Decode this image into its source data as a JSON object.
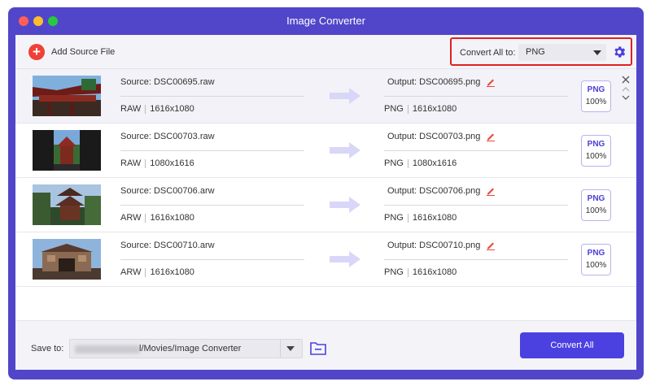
{
  "window": {
    "title": "Image Converter"
  },
  "toolbar": {
    "add_label": "Add Source File",
    "convert_all_label": "Convert All to:",
    "format_selected": "PNG"
  },
  "files": [
    {
      "source_name": "Source: DSC00695.raw",
      "source_format": "RAW",
      "source_dims": "1616x1080",
      "output_name": "Output: DSC00695.png",
      "output_format": "PNG",
      "output_dims": "1616x1080",
      "badge_format": "PNG",
      "badge_quality": "100%",
      "selected": true
    },
    {
      "source_name": "Source: DSC00703.raw",
      "source_format": "RAW",
      "source_dims": "1080x1616",
      "output_name": "Output: DSC00703.png",
      "output_format": "PNG",
      "output_dims": "1080x1616",
      "badge_format": "PNG",
      "badge_quality": "100%",
      "selected": false
    },
    {
      "source_name": "Source: DSC00706.arw",
      "source_format": "ARW",
      "source_dims": "1616x1080",
      "output_name": "Output: DSC00706.png",
      "output_format": "PNG",
      "output_dims": "1616x1080",
      "badge_format": "PNG",
      "badge_quality": "100%",
      "selected": false
    },
    {
      "source_name": "Source: DSC00710.arw",
      "source_format": "ARW",
      "source_dims": "1616x1080",
      "output_name": "Output: DSC00710.png",
      "output_format": "PNG",
      "output_dims": "1616x1080",
      "badge_format": "PNG",
      "badge_quality": "100%",
      "selected": false
    }
  ],
  "footer": {
    "save_label": "Save to:",
    "save_path_visible": "l/Movies/Image Converter",
    "convert_button": "Convert All"
  },
  "colors": {
    "accent": "#4b40e0",
    "window_frame": "#5146c9",
    "highlight_border": "#e02020",
    "add_icon": "#ef4136"
  }
}
